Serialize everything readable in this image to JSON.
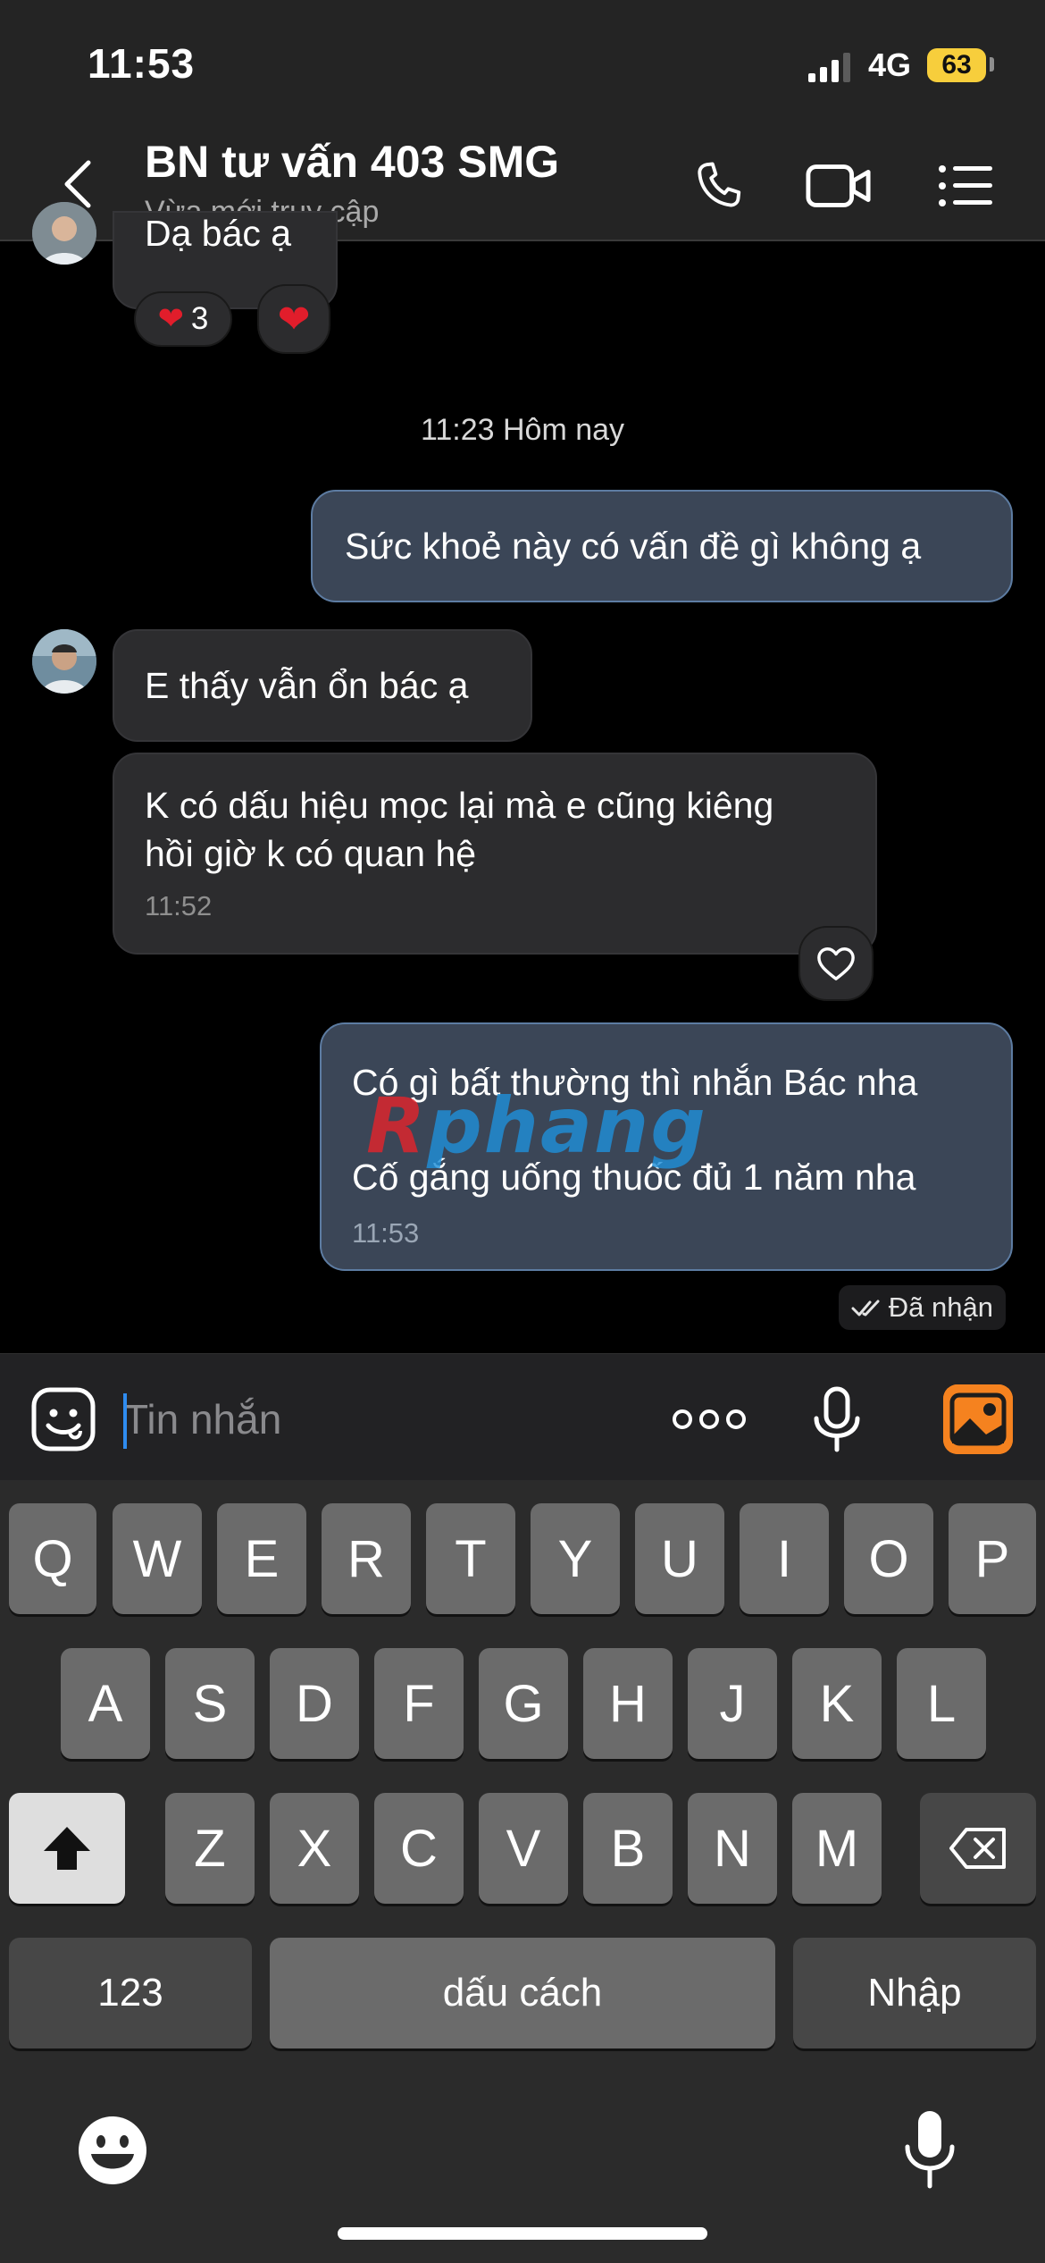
{
  "status_bar": {
    "time": "11:53",
    "network": "4G",
    "battery": "63",
    "battery_color": "#f7ce3c"
  },
  "header": {
    "title": "BN tư vấn 403 SMG",
    "subtitle": "Vừa mới truy cập",
    "icons": [
      "back-chevron-icon",
      "phone-icon",
      "video-call-icon",
      "menu-list-icon"
    ]
  },
  "messages": {
    "partial_in": {
      "text": "Dạ bác ạ",
      "reaction_count": "3"
    },
    "date_divider": "11:23 Hôm nay",
    "out_1": {
      "text": "Sức khoẻ này có vấn đề gì không ạ"
    },
    "in_1": {
      "text": "E thấy vẫn ổn bác ạ"
    },
    "in_2": {
      "line1": "K có dấu hiệu mọc lại mà e cũng kiêng",
      "line2": "hồi giờ k có quan hệ",
      "time": "11:52"
    },
    "out_2": {
      "line1": "Có gì bất thường thì nhắn Bác nha",
      "line2": "Cố gắng uống thuốc đủ 1 năm nha",
      "time": "11:53"
    },
    "read_status": "Đã nhận"
  },
  "watermark": {
    "part1": "R",
    "part2": "phang"
  },
  "input_bar": {
    "placeholder": "Tin nhắn",
    "value": ""
  },
  "keyboard": {
    "row1": [
      "Q",
      "W",
      "E",
      "R",
      "T",
      "Y",
      "U",
      "I",
      "O",
      "P"
    ],
    "row2": [
      "A",
      "S",
      "D",
      "F",
      "G",
      "H",
      "J",
      "K",
      "L"
    ],
    "row3": [
      "Z",
      "X",
      "C",
      "V",
      "B",
      "N",
      "M"
    ],
    "numbers_key": "123",
    "space_key": "dấu cách",
    "return_key": "Nhập"
  },
  "colors": {
    "accent": "#2f8cf0",
    "outgoing_bubble": "#3b4657",
    "incoming_bubble": "#2c2c2e",
    "image_button": "#f5821f",
    "heart": "#e11d2b"
  }
}
